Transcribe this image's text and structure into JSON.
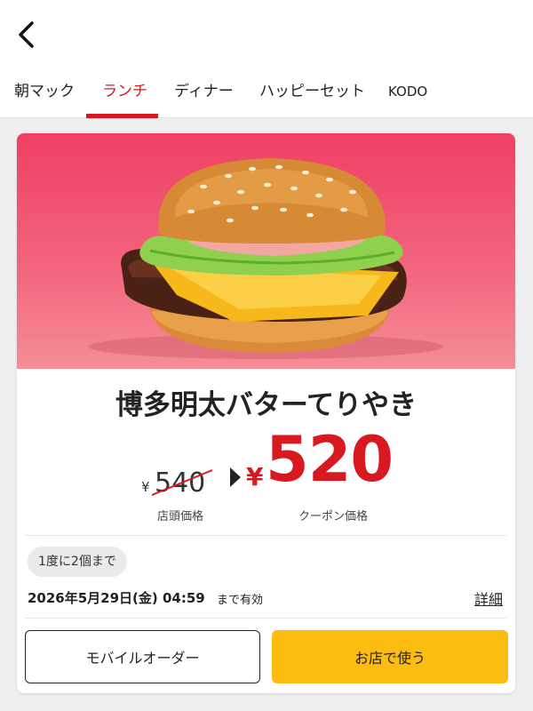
{
  "nav": {
    "back_icon": "chevron-left-icon",
    "tabs": [
      {
        "label": "朝マック",
        "active": false
      },
      {
        "label": "ランチ",
        "active": true
      },
      {
        "label": "ディナー",
        "active": false
      },
      {
        "label": "ハッピーセット",
        "active": false
      },
      {
        "label": "KODO",
        "active": false
      }
    ],
    "active_color": "#d81a20"
  },
  "coupon": {
    "image_icon": "burger-image",
    "title": "博多明太バターてりやき",
    "regular_price": {
      "currency": "¥",
      "amount": "540",
      "label": "店頭価格"
    },
    "coupon_price": {
      "currency": "¥",
      "amount": "520",
      "label": "クーポン価格"
    },
    "limit": "1度に2個まで",
    "expiry_date": "2026年5月29日(金) 04:59",
    "expiry_suffix": "まで有効",
    "details_label": "詳細",
    "price_color": "#d81a20"
  },
  "actions": {
    "mobile_order_label": "モバイルオーダー",
    "use_in_store_label": "お店で使う",
    "use_in_store_color": "#fdbd10"
  }
}
